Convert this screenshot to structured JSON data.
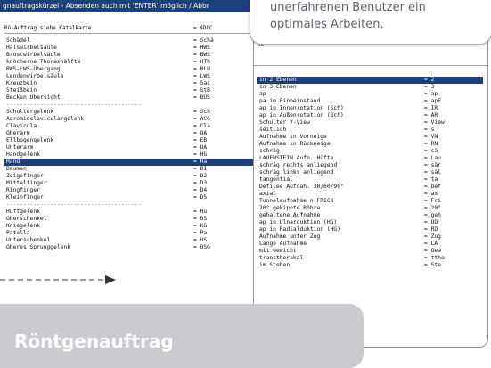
{
  "left_window": {
    "title": "gnauftragskürzel - Absenden auch mit 'ENTER' möglich / Abbr",
    "header_key": "Rö-Auftrag siehe Katalkarte",
    "header_value": "= $DOC",
    "rows": [
      {
        "k": "Schädel",
        "v": "= Schä"
      },
      {
        "k": "Halswirbelsäule",
        "v": "= HWS"
      },
      {
        "k": "Brustwirbelsäule",
        "v": "= BWS"
      },
      {
        "k": "knöcherne Thoraxhälfte",
        "v": "= HTh"
      },
      {
        "k": "BWS-LWS-Übergang",
        "v": "= BLU"
      },
      {
        "k": "Lendenwirbelsäule",
        "v": "= LWS"
      },
      {
        "k": "Kreuzbein",
        "v": "= Sac"
      },
      {
        "k": "Steißbein",
        "v": "= StB"
      },
      {
        "k": "Becken Übersicht",
        "v": "= BÜS"
      },
      {
        "k": "----------------------------------------",
        "v": "",
        "sep": true
      },
      {
        "k": "Schultergelenk",
        "v": "= Sch"
      },
      {
        "k": "Acromioclaviculargelenk",
        "v": "= ACG"
      },
      {
        "k": "Clavicula",
        "v": "= Cla"
      },
      {
        "k": "Oberarm",
        "v": "= OA"
      },
      {
        "k": "Ellbogengelenk",
        "v": "= EB"
      },
      {
        "k": "Unterarm",
        "v": "= UA"
      },
      {
        "k": "Handgelenk",
        "v": "= HG"
      },
      {
        "k": "Hand",
        "v": "= Ha",
        "sel": true
      },
      {
        "k": "Daumen",
        "v": "= D1"
      },
      {
        "k": "Zeigefinger",
        "v": "= D2"
      },
      {
        "k": "Mittelfinger",
        "v": "= D3"
      },
      {
        "k": "Ringfinger",
        "v": "= D4"
      },
      {
        "k": "Kleinfinger",
        "v": "= D5"
      },
      {
        "k": "----------------------------------------",
        "v": "",
        "sep": true
      },
      {
        "k": "Hüftgelenk",
        "v": "= Hü"
      },
      {
        "k": "Oberschenkel",
        "v": "= OS"
      },
      {
        "k": "Kniegelenk",
        "v": "= KG"
      },
      {
        "k": "Patella",
        "v": "= Pa"
      },
      {
        "k": "Unterschenkel",
        "v": "= US"
      },
      {
        "k": "Oberes Sprunggelenk",
        "v": "= OSG"
      }
    ]
  },
  "right_window": {
    "fragment": "Ge",
    "rows": [
      {
        "k": "in 2 Ebenen",
        "v": "= 2",
        "sel": true
      },
      {
        "k": "in 3 Ebenen",
        "v": "= 3"
      },
      {
        "k": "ap",
        "v": "= ap"
      },
      {
        "k": "pa im Einbeinstand",
        "v": "= apE"
      },
      {
        "k": "ap in Innenrotation (Sch)",
        "v": "= IR"
      },
      {
        "k": "ap in Außenrotation (Sch)",
        "v": "= AR"
      },
      {
        "k": "Schulter Y-View",
        "v": "= View"
      },
      {
        "k": "seitlich",
        "v": "= s"
      },
      {
        "k": "Aufnahme in Vorneige",
        "v": "= VN"
      },
      {
        "k": "Aufnahme in Rückneige",
        "v": "= RN"
      },
      {
        "k": "schräg",
        "v": "= sä"
      },
      {
        "k": "LAUENSTEIN Aufn. Hüfte",
        "v": "= Lau"
      },
      {
        "k": "schräg rechts anliegend",
        "v": "= sär"
      },
      {
        "k": "schräg links anliegend",
        "v": "= säl"
      },
      {
        "k": "tangential",
        "v": "= ta"
      },
      {
        "k": "Defilée Aufnah. 30/60/90°",
        "v": "= Def"
      },
      {
        "k": "axial",
        "v": "= ax"
      },
      {
        "k": "Tunnelaufnahme n FRICK",
        "v": "= Fri"
      },
      {
        "k": "20° gekippte Röhre",
        "v": "= 20°"
      },
      {
        "k": "gehaltene Aufnahme",
        "v": "= geh"
      },
      {
        "k": "ap in Ulnarduktion (HG)",
        "v": "= UD"
      },
      {
        "k": "ap in Radialduktion (HG)",
        "v": "= RD"
      },
      {
        "k": "Aufnahme unter Zug",
        "v": "= Zug"
      },
      {
        "k": "Lange Aufnahme",
        "v": "= LA"
      },
      {
        "k": "mit Gewicht",
        "v": "= Gew"
      },
      {
        "k": "transthorakal",
        "v": "= ttho"
      },
      {
        "k": "im Stehen",
        "v": "= Ste"
      }
    ]
  },
  "tooltip": {
    "line1": "unerfahrenen Benutzer ein",
    "line2": "optimales Arbeiten."
  },
  "callout": {
    "label": "Röntgenauftrag"
  },
  "colors": {
    "selection": "#1f3f78",
    "callout_bg": "#c9cbce",
    "tooltip_text": "#5d6470"
  }
}
